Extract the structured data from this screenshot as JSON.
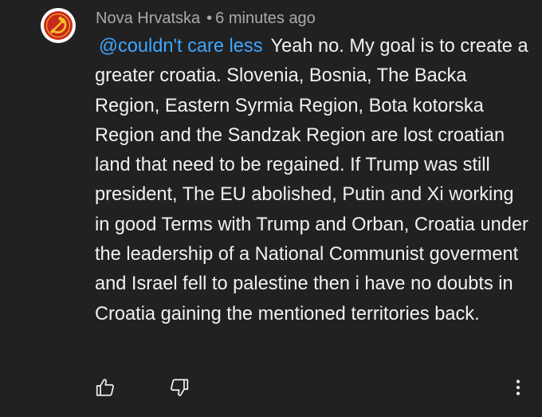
{
  "comment": {
    "author": "Nova Hrvatska",
    "separator": "•",
    "timestamp": "6 minutes ago",
    "mention": "@couldn't care less",
    "text": "Yeah no. My goal is to create a greater croatia. Slovenia, Bosnia, The Backa Region, Eastern Syrmia Region, Bota kotorska Region and the Sandzak Region are lost croatian land that need to be regained. If Trump was still president, The EU abolished, Putin and Xi working in good Terms with Trump and Orban, Croatia under the leadership of a National Communist goverment and Israel fell to palestine then i have no doubts in Croatia gaining the mentioned territories back.",
    "avatar_icon": "hammer-sickle-emblem",
    "actions": {
      "like_icon": "thumbs-up-icon",
      "dislike_icon": "thumbs-down-icon",
      "more_icon": "more-vertical-icon"
    }
  },
  "colors": {
    "background": "#212121",
    "text": "#f1f1f1",
    "meta": "#aaaaaa",
    "mention": "#3ea6ff",
    "avatar_red": "#c8281e",
    "avatar_bg": "#ffffff"
  }
}
